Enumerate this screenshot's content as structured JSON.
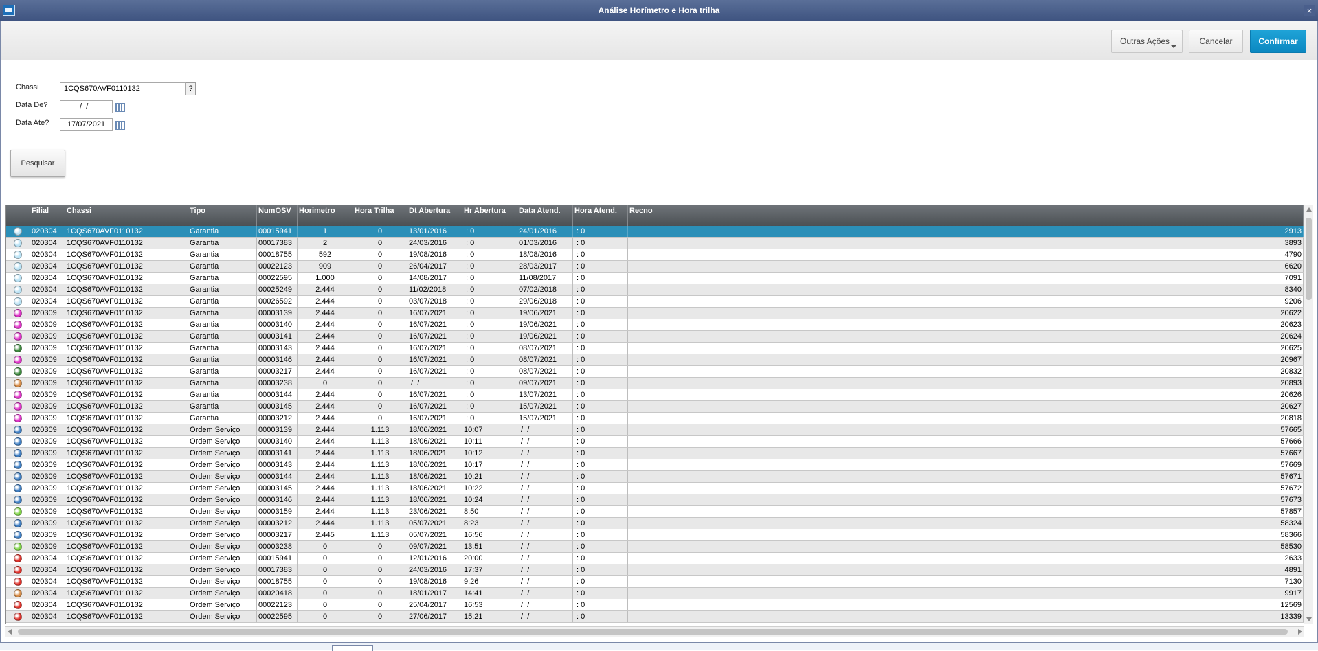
{
  "window": {
    "title": "Análise Horímetro e Hora trilha"
  },
  "toolbar": {
    "other_actions_label": "Outras Ações",
    "cancel_label": "Cancelar",
    "confirm_label": "Confirmar"
  },
  "colors": {
    "confirm_button": "#0b88c1",
    "header_bg": "#5a5f64",
    "selected_row": "#2b8fb8",
    "titlebar": "#4a5f8c"
  },
  "form": {
    "chassi_label": "Chassi",
    "chassi_value": "1CQS670AVF0110132",
    "help_label": "?",
    "data_de_label": "Data De?",
    "data_de_value": "  /  /",
    "data_ate_label": "Data Ate?",
    "data_ate_value": "17/07/2021",
    "search_label": "Pesquisar"
  },
  "table": {
    "columns": [
      "",
      "Filial",
      "Chassi",
      "Tipo",
      "NumOSV",
      "Horimetro",
      "Hora Trilha",
      "Dt Abertura",
      "Hr Abertura",
      "Data Atend.",
      "Hora Atend.",
      "Recno"
    ],
    "status_colors": {
      "lightblue": "#b9e2f5",
      "magenta": "#e033c9",
      "darkgreen": "#3d8a3d",
      "orange": "#d98e48",
      "blue": "#3f7fc4",
      "lightgreen": "#7fd444",
      "red": "#e0312a"
    },
    "rows": [
      {
        "status": "lightblue",
        "filial": "020304",
        "chassi": "1CQS670AVF0110132",
        "tipo": "Garantia",
        "numosv": "00015941",
        "horimetro": "1",
        "hora_trilha": "0",
        "dt_abertura": "13/01/2016",
        "hr_abertura": " : 0",
        "data_atend": "24/01/2016",
        "hora_atend": " : 0",
        "recno": "2913"
      },
      {
        "status": "lightblue",
        "filial": "020304",
        "chassi": "1CQS670AVF0110132",
        "tipo": "Garantia",
        "numosv": "00017383",
        "horimetro": "2",
        "hora_trilha": "0",
        "dt_abertura": "24/03/2016",
        "hr_abertura": " : 0",
        "data_atend": "01/03/2016",
        "hora_atend": " : 0",
        "recno": "3893"
      },
      {
        "status": "lightblue",
        "filial": "020304",
        "chassi": "1CQS670AVF0110132",
        "tipo": "Garantia",
        "numosv": "00018755",
        "horimetro": "592",
        "hora_trilha": "0",
        "dt_abertura": "19/08/2016",
        "hr_abertura": " : 0",
        "data_atend": "18/08/2016",
        "hora_atend": " : 0",
        "recno": "4790"
      },
      {
        "status": "lightblue",
        "filial": "020304",
        "chassi": "1CQS670AVF0110132",
        "tipo": "Garantia",
        "numosv": "00022123",
        "horimetro": "909",
        "hora_trilha": "0",
        "dt_abertura": "26/04/2017",
        "hr_abertura": " : 0",
        "data_atend": "28/03/2017",
        "hora_atend": " : 0",
        "recno": "6620"
      },
      {
        "status": "lightblue",
        "filial": "020304",
        "chassi": "1CQS670AVF0110132",
        "tipo": "Garantia",
        "numosv": "00022595",
        "horimetro": "1.000",
        "hora_trilha": "0",
        "dt_abertura": "14/08/2017",
        "hr_abertura": " : 0",
        "data_atend": "11/08/2017",
        "hora_atend": " : 0",
        "recno": "7091"
      },
      {
        "status": "lightblue",
        "filial": "020304",
        "chassi": "1CQS670AVF0110132",
        "tipo": "Garantia",
        "numosv": "00025249",
        "horimetro": "2.444",
        "hora_trilha": "0",
        "dt_abertura": "11/02/2018",
        "hr_abertura": " : 0",
        "data_atend": "07/02/2018",
        "hora_atend": " : 0",
        "recno": "8340"
      },
      {
        "status": "lightblue",
        "filial": "020304",
        "chassi": "1CQS670AVF0110132",
        "tipo": "Garantia",
        "numosv": "00026592",
        "horimetro": "2.444",
        "hora_trilha": "0",
        "dt_abertura": "03/07/2018",
        "hr_abertura": " : 0",
        "data_atend": "29/06/2018",
        "hora_atend": " : 0",
        "recno": "9206"
      },
      {
        "status": "magenta",
        "filial": "020309",
        "chassi": "1CQS670AVF0110132",
        "tipo": "Garantia",
        "numosv": "00003139",
        "horimetro": "2.444",
        "hora_trilha": "0",
        "dt_abertura": "16/07/2021",
        "hr_abertura": " : 0",
        "data_atend": "19/06/2021",
        "hora_atend": " : 0",
        "recno": "20622"
      },
      {
        "status": "magenta",
        "filial": "020309",
        "chassi": "1CQS670AVF0110132",
        "tipo": "Garantia",
        "numosv": "00003140",
        "horimetro": "2.444",
        "hora_trilha": "0",
        "dt_abertura": "16/07/2021",
        "hr_abertura": " : 0",
        "data_atend": "19/06/2021",
        "hora_atend": " : 0",
        "recno": "20623"
      },
      {
        "status": "magenta",
        "filial": "020309",
        "chassi": "1CQS670AVF0110132",
        "tipo": "Garantia",
        "numosv": "00003141",
        "horimetro": "2.444",
        "hora_trilha": "0",
        "dt_abertura": "16/07/2021",
        "hr_abertura": " : 0",
        "data_atend": "19/06/2021",
        "hora_atend": " : 0",
        "recno": "20624"
      },
      {
        "status": "darkgreen",
        "filial": "020309",
        "chassi": "1CQS670AVF0110132",
        "tipo": "Garantia",
        "numosv": "00003143",
        "horimetro": "2.444",
        "hora_trilha": "0",
        "dt_abertura": "16/07/2021",
        "hr_abertura": " : 0",
        "data_atend": "08/07/2021",
        "hora_atend": " : 0",
        "recno": "20625"
      },
      {
        "status": "magenta",
        "filial": "020309",
        "chassi": "1CQS670AVF0110132",
        "tipo": "Garantia",
        "numosv": "00003146",
        "horimetro": "2.444",
        "hora_trilha": "0",
        "dt_abertura": "16/07/2021",
        "hr_abertura": " : 0",
        "data_atend": "08/07/2021",
        "hora_atend": " : 0",
        "recno": "20967"
      },
      {
        "status": "darkgreen",
        "filial": "020309",
        "chassi": "1CQS670AVF0110132",
        "tipo": "Garantia",
        "numosv": "00003217",
        "horimetro": "2.444",
        "hora_trilha": "0",
        "dt_abertura": "16/07/2021",
        "hr_abertura": " : 0",
        "data_atend": "08/07/2021",
        "hora_atend": " : 0",
        "recno": "20832"
      },
      {
        "status": "orange",
        "filial": "020309",
        "chassi": "1CQS670AVF0110132",
        "tipo": "Garantia",
        "numosv": "00003238",
        "horimetro": "0",
        "hora_trilha": "0",
        "dt_abertura": " /  /",
        "hr_abertura": " : 0",
        "data_atend": "09/07/2021",
        "hora_atend": " : 0",
        "recno": "20893"
      },
      {
        "status": "magenta",
        "filial": "020309",
        "chassi": "1CQS670AVF0110132",
        "tipo": "Garantia",
        "numosv": "00003144",
        "horimetro": "2.444",
        "hora_trilha": "0",
        "dt_abertura": "16/07/2021",
        "hr_abertura": " : 0",
        "data_atend": "13/07/2021",
        "hora_atend": " : 0",
        "recno": "20626"
      },
      {
        "status": "magenta",
        "filial": "020309",
        "chassi": "1CQS670AVF0110132",
        "tipo": "Garantia",
        "numosv": "00003145",
        "horimetro": "2.444",
        "hora_trilha": "0",
        "dt_abertura": "16/07/2021",
        "hr_abertura": " : 0",
        "data_atend": "15/07/2021",
        "hora_atend": " : 0",
        "recno": "20627"
      },
      {
        "status": "magenta",
        "filial": "020309",
        "chassi": "1CQS670AVF0110132",
        "tipo": "Garantia",
        "numosv": "00003212",
        "horimetro": "2.444",
        "hora_trilha": "0",
        "dt_abertura": "16/07/2021",
        "hr_abertura": " : 0",
        "data_atend": "15/07/2021",
        "hora_atend": " : 0",
        "recno": "20818"
      },
      {
        "status": "blue",
        "filial": "020309",
        "chassi": "1CQS670AVF0110132",
        "tipo": "Ordem Serviço",
        "numosv": "00003139",
        "horimetro": "2.444",
        "hora_trilha": "1.113",
        "dt_abertura": "18/06/2021",
        "hr_abertura": "10:07",
        "data_atend": " /  /",
        "hora_atend": " : 0",
        "recno": "57665"
      },
      {
        "status": "blue",
        "filial": "020309",
        "chassi": "1CQS670AVF0110132",
        "tipo": "Ordem Serviço",
        "numosv": "00003140",
        "horimetro": "2.444",
        "hora_trilha": "1.113",
        "dt_abertura": "18/06/2021",
        "hr_abertura": "10:11",
        "data_atend": " /  /",
        "hora_atend": " : 0",
        "recno": "57666"
      },
      {
        "status": "blue",
        "filial": "020309",
        "chassi": "1CQS670AVF0110132",
        "tipo": "Ordem Serviço",
        "numosv": "00003141",
        "horimetro": "2.444",
        "hora_trilha": "1.113",
        "dt_abertura": "18/06/2021",
        "hr_abertura": "10:12",
        "data_atend": " /  /",
        "hora_atend": " : 0",
        "recno": "57667"
      },
      {
        "status": "blue",
        "filial": "020309",
        "chassi": "1CQS670AVF0110132",
        "tipo": "Ordem Serviço",
        "numosv": "00003143",
        "horimetro": "2.444",
        "hora_trilha": "1.113",
        "dt_abertura": "18/06/2021",
        "hr_abertura": "10:17",
        "data_atend": " /  /",
        "hora_atend": " : 0",
        "recno": "57669"
      },
      {
        "status": "blue",
        "filial": "020309",
        "chassi": "1CQS670AVF0110132",
        "tipo": "Ordem Serviço",
        "numosv": "00003144",
        "horimetro": "2.444",
        "hora_trilha": "1.113",
        "dt_abertura": "18/06/2021",
        "hr_abertura": "10:21",
        "data_atend": " /  /",
        "hora_atend": " : 0",
        "recno": "57671"
      },
      {
        "status": "blue",
        "filial": "020309",
        "chassi": "1CQS670AVF0110132",
        "tipo": "Ordem Serviço",
        "numosv": "00003145",
        "horimetro": "2.444",
        "hora_trilha": "1.113",
        "dt_abertura": "18/06/2021",
        "hr_abertura": "10:22",
        "data_atend": " /  /",
        "hora_atend": " : 0",
        "recno": "57672"
      },
      {
        "status": "blue",
        "filial": "020309",
        "chassi": "1CQS670AVF0110132",
        "tipo": "Ordem Serviço",
        "numosv": "00003146",
        "horimetro": "2.444",
        "hora_trilha": "1.113",
        "dt_abertura": "18/06/2021",
        "hr_abertura": "10:24",
        "data_atend": " /  /",
        "hora_atend": " : 0",
        "recno": "57673"
      },
      {
        "status": "lightgreen",
        "filial": "020309",
        "chassi": "1CQS670AVF0110132",
        "tipo": "Ordem Serviço",
        "numosv": "00003159",
        "horimetro": "2.444",
        "hora_trilha": "1.113",
        "dt_abertura": "23/06/2021",
        "hr_abertura": "8:50",
        "data_atend": " /  /",
        "hora_atend": " : 0",
        "recno": "57857"
      },
      {
        "status": "blue",
        "filial": "020309",
        "chassi": "1CQS670AVF0110132",
        "tipo": "Ordem Serviço",
        "numosv": "00003212",
        "horimetro": "2.444",
        "hora_trilha": "1.113",
        "dt_abertura": "05/07/2021",
        "hr_abertura": "8:23",
        "data_atend": " /  /",
        "hora_atend": " : 0",
        "recno": "58324"
      },
      {
        "status": "blue",
        "filial": "020309",
        "chassi": "1CQS670AVF0110132",
        "tipo": "Ordem Serviço",
        "numosv": "00003217",
        "horimetro": "2.445",
        "hora_trilha": "1.113",
        "dt_abertura": "05/07/2021",
        "hr_abertura": "16:56",
        "data_atend": " /  /",
        "hora_atend": " : 0",
        "recno": "58366"
      },
      {
        "status": "lightgreen",
        "filial": "020309",
        "chassi": "1CQS670AVF0110132",
        "tipo": "Ordem Serviço",
        "numosv": "00003238",
        "horimetro": "0",
        "hora_trilha": "0",
        "dt_abertura": "09/07/2021",
        "hr_abertura": "13:51",
        "data_atend": " /  /",
        "hora_atend": " : 0",
        "recno": "58530"
      },
      {
        "status": "red",
        "filial": "020304",
        "chassi": "1CQS670AVF0110132",
        "tipo": "Ordem Serviço",
        "numosv": "00015941",
        "horimetro": "0",
        "hora_trilha": "0",
        "dt_abertura": "12/01/2016",
        "hr_abertura": "20:00",
        "data_atend": " /  /",
        "hora_atend": " : 0",
        "recno": "2633"
      },
      {
        "status": "red",
        "filial": "020304",
        "chassi": "1CQS670AVF0110132",
        "tipo": "Ordem Serviço",
        "numosv": "00017383",
        "horimetro": "0",
        "hora_trilha": "0",
        "dt_abertura": "24/03/2016",
        "hr_abertura": "17:37",
        "data_atend": " /  /",
        "hora_atend": " : 0",
        "recno": "4891"
      },
      {
        "status": "red",
        "filial": "020304",
        "chassi": "1CQS670AVF0110132",
        "tipo": "Ordem Serviço",
        "numosv": "00018755",
        "horimetro": "0",
        "hora_trilha": "0",
        "dt_abertura": "19/08/2016",
        "hr_abertura": "9:26",
        "data_atend": " /  /",
        "hora_atend": " : 0",
        "recno": "7130"
      },
      {
        "status": "orange",
        "filial": "020304",
        "chassi": "1CQS670AVF0110132",
        "tipo": "Ordem Serviço",
        "numosv": "00020418",
        "horimetro": "0",
        "hora_trilha": "0",
        "dt_abertura": "18/01/2017",
        "hr_abertura": "14:41",
        "data_atend": " /  /",
        "hora_atend": " : 0",
        "recno": "9917"
      },
      {
        "status": "red",
        "filial": "020304",
        "chassi": "1CQS670AVF0110132",
        "tipo": "Ordem Serviço",
        "numosv": "00022123",
        "horimetro": "0",
        "hora_trilha": "0",
        "dt_abertura": "25/04/2017",
        "hr_abertura": "16:53",
        "data_atend": " /  /",
        "hora_atend": " : 0",
        "recno": "12569"
      },
      {
        "status": "red",
        "filial": "020304",
        "chassi": "1CQS670AVF0110132",
        "tipo": "Ordem Serviço",
        "numosv": "00022595",
        "horimetro": "0",
        "hora_trilha": "0",
        "dt_abertura": "27/06/2017",
        "hr_abertura": "15:21",
        "data_atend": " /  /",
        "hora_atend": " : 0",
        "recno": "13339"
      }
    ]
  }
}
